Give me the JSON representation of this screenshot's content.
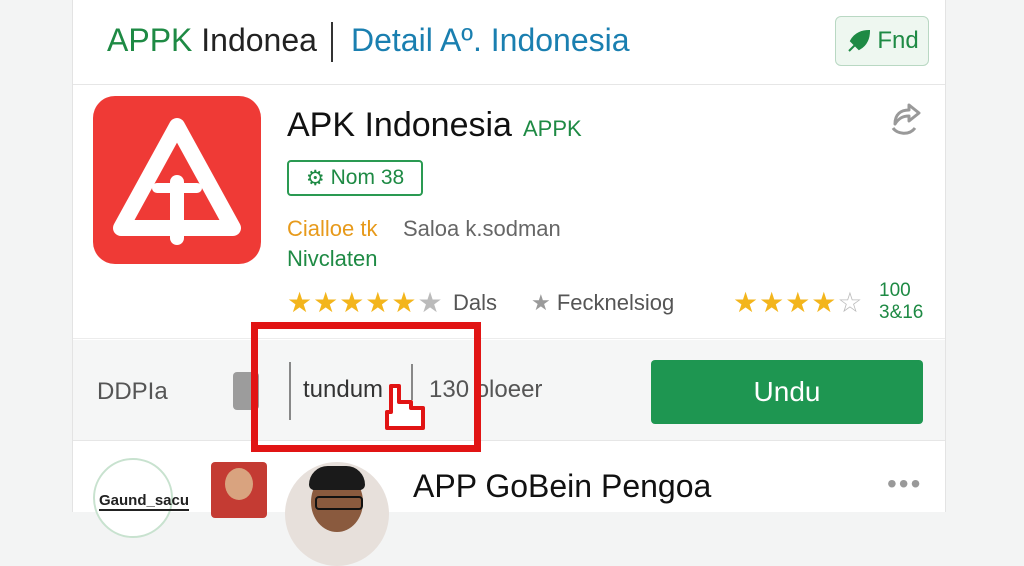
{
  "header": {
    "brand_prefix": "APPK",
    "brand_rest": "Indonea",
    "title": "Detail Aº. Indonesia",
    "find_label": "Fnd"
  },
  "app": {
    "name": "APK Indonesia",
    "tag": "APPK",
    "badge": "Nom 38",
    "category": "Cialloe tk",
    "subcategory": "Saloa k.sodman",
    "developer": "Nivclaten",
    "rating_label": "Dals",
    "feature_label": "Fecknelsiog",
    "rating_number_1": "100",
    "rating_number_2": "3&16",
    "stars_left": 4.5,
    "stars_right": 4.5
  },
  "download": {
    "label": "DDPIa",
    "input_text": "tundum",
    "count_text": "130 oloeer",
    "button_label": "Undu"
  },
  "related": {
    "title": "APP GoBein Pengoa",
    "avatar_text": "Gaund_sacu"
  },
  "colors": {
    "accent_green": "#1e9651",
    "brand_blue": "#1a7fb0",
    "icon_red": "#ef3a36",
    "highlight_red": "#e11414",
    "star_gold": "#f3b51c"
  },
  "icons": [
    "leaf-find-icon",
    "share-icon",
    "app-logo-icon",
    "badge-icon",
    "star-icon",
    "cursor-hand-icon",
    "more-icon"
  ]
}
